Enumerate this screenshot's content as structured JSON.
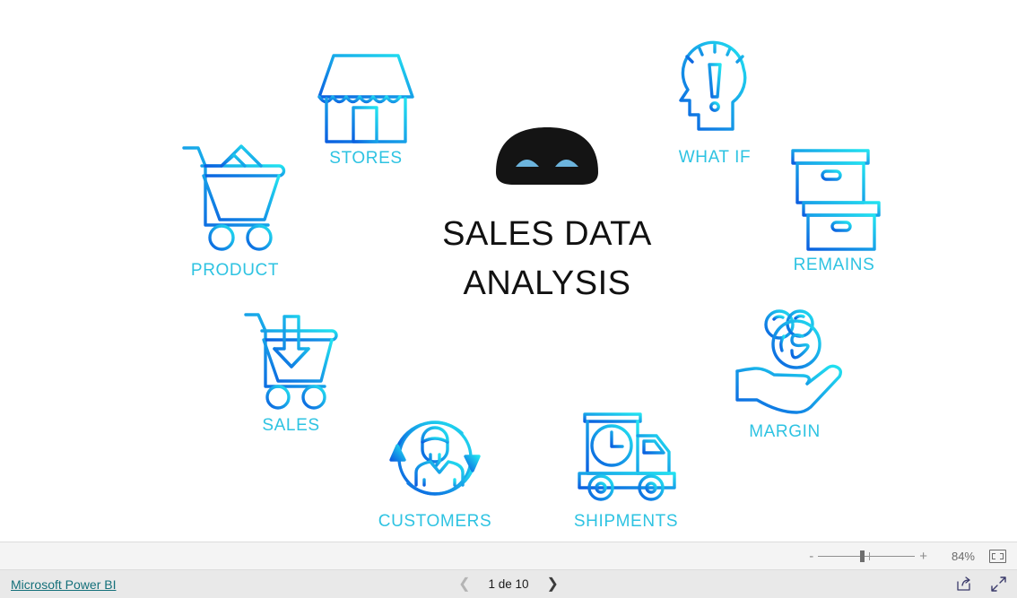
{
  "report": {
    "title_line1": "SALES DATA",
    "title_line2": "ANALYSIS",
    "robot_icon": "robot-face-icon",
    "nodes": [
      {
        "key": "stores",
        "label": "STORES",
        "icon": "storefront-icon"
      },
      {
        "key": "what_if",
        "label": "WHAT IF",
        "icon": "head-exclamation-icon"
      },
      {
        "key": "remains",
        "label": "REMAINS",
        "icon": "stacked-boxes-icon"
      },
      {
        "key": "margin",
        "label": "MARGIN",
        "icon": "hand-coins-dollar-icon"
      },
      {
        "key": "shipments",
        "label": "SHIPMENTS",
        "icon": "delivery-truck-clock-icon"
      },
      {
        "key": "customers",
        "label": "CUSTOMERS",
        "icon": "customer-refresh-icon"
      },
      {
        "key": "sales",
        "label": "SALES",
        "icon": "cart-down-arrow-icon"
      },
      {
        "key": "product",
        "label": "PRODUCT",
        "icon": "cart-goods-icon"
      }
    ]
  },
  "zoombar": {
    "minus_label": "-",
    "plus_label": "+",
    "zoom_level": "84%",
    "fit_icon": "fit-to-page-icon",
    "slider_icon": "zoom-slider"
  },
  "navbar": {
    "brand_link": "Microsoft Power BI",
    "prev_icon": "chevron-left-icon",
    "next_icon": "chevron-right-icon",
    "page_label": "1 de 10",
    "share_icon": "share-icon",
    "fullscreen_icon": "fullscreen-icon"
  },
  "colors": {
    "label": "#2ec3e2",
    "gradient_start": "#22e3f0",
    "gradient_end": "#0b5fe0",
    "link": "#14707a",
    "robot_body": "#141414",
    "robot_eye": "#6cb4dd"
  }
}
